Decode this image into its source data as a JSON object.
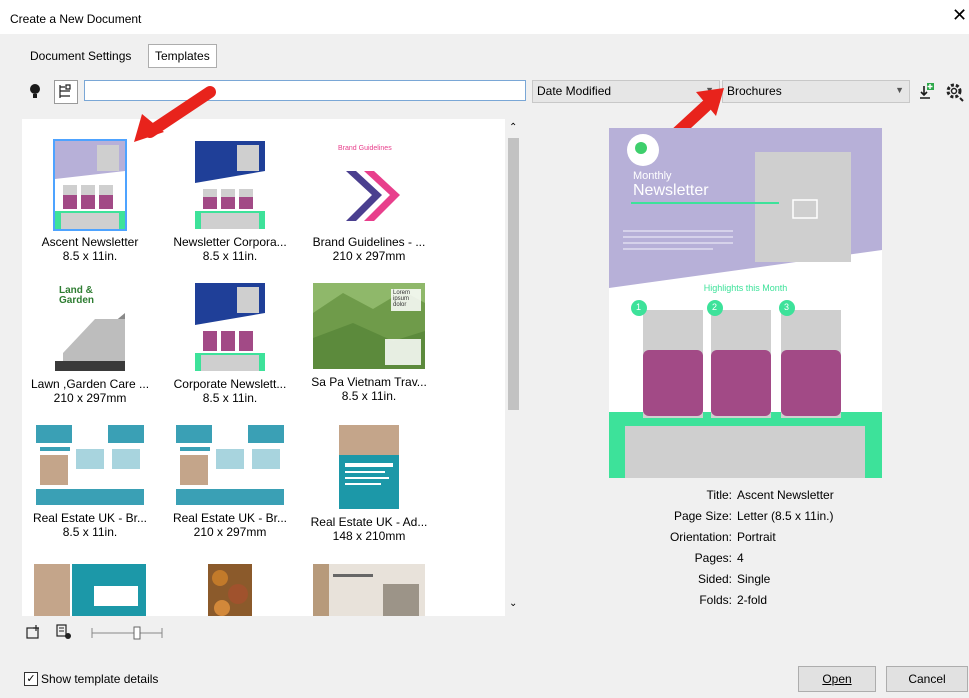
{
  "window": {
    "title": "Create a New Document",
    "close_glyph": "✕"
  },
  "tabs": [
    {
      "label": "Document Settings"
    },
    {
      "label": "Templates"
    }
  ],
  "toolbar": {
    "search_value": "",
    "sort_value": "Date Modified",
    "category_value": "Brochures"
  },
  "templates": [
    {
      "name": "Ascent Newsletter",
      "size": "8.5 x 11in."
    },
    {
      "name": "Newsletter Corpora...",
      "size": "8.5 x 11in."
    },
    {
      "name": "Brand Guidelines - ...",
      "size": "210 x 297mm"
    },
    {
      "name": "Lawn ,Garden Care ...",
      "size": "210 x 297mm"
    },
    {
      "name": "Corporate Newslett...",
      "size": "8.5 x 11in."
    },
    {
      "name": "Sa Pa Vietnam Trav...",
      "size": "8.5 x 11in."
    },
    {
      "name": "Real Estate UK - Br...",
      "size": "8.5 x 11in."
    },
    {
      "name": "Real Estate UK - Br...",
      "size": "210 x 297mm"
    },
    {
      "name": "Real Estate UK - Ad...",
      "size": "148 x 210mm"
    }
  ],
  "thumb_text": {
    "brand_title": "Brand Guidelines",
    "garden_title_1": "Land &",
    "garden_title_2": "Garden",
    "travel_title": "Lorem ipsum dolor"
  },
  "preview": {
    "kicker": "Monthly",
    "title": "Newsletter",
    "highlights": "Highlights this Month",
    "numbers": [
      "1",
      "2",
      "3"
    ]
  },
  "details": {
    "title_label": "Title:",
    "title_value": "Ascent Newsletter",
    "pagesize_label": "Page Size:",
    "pagesize_value": "Letter (8.5 x 11in.)",
    "orientation_label": "Orientation:",
    "orientation_value": "Portrait",
    "pages_label": "Pages:",
    "pages_value": "4",
    "sided_label": "Sided:",
    "sided_value": "Single",
    "folds_label": "Folds:",
    "folds_value": "2-fold"
  },
  "footer": {
    "show_details_label": "Show template details",
    "show_details_checked": true,
    "open_label": "Open",
    "cancel_label": "Cancel"
  },
  "colors": {
    "accent_blue": "#0078d7",
    "annotation_red": "#e8231c",
    "newsletter_lavender": "#b7b0d8",
    "newsletter_green": "#3de29a",
    "newsletter_magenta": "#a24a86"
  }
}
